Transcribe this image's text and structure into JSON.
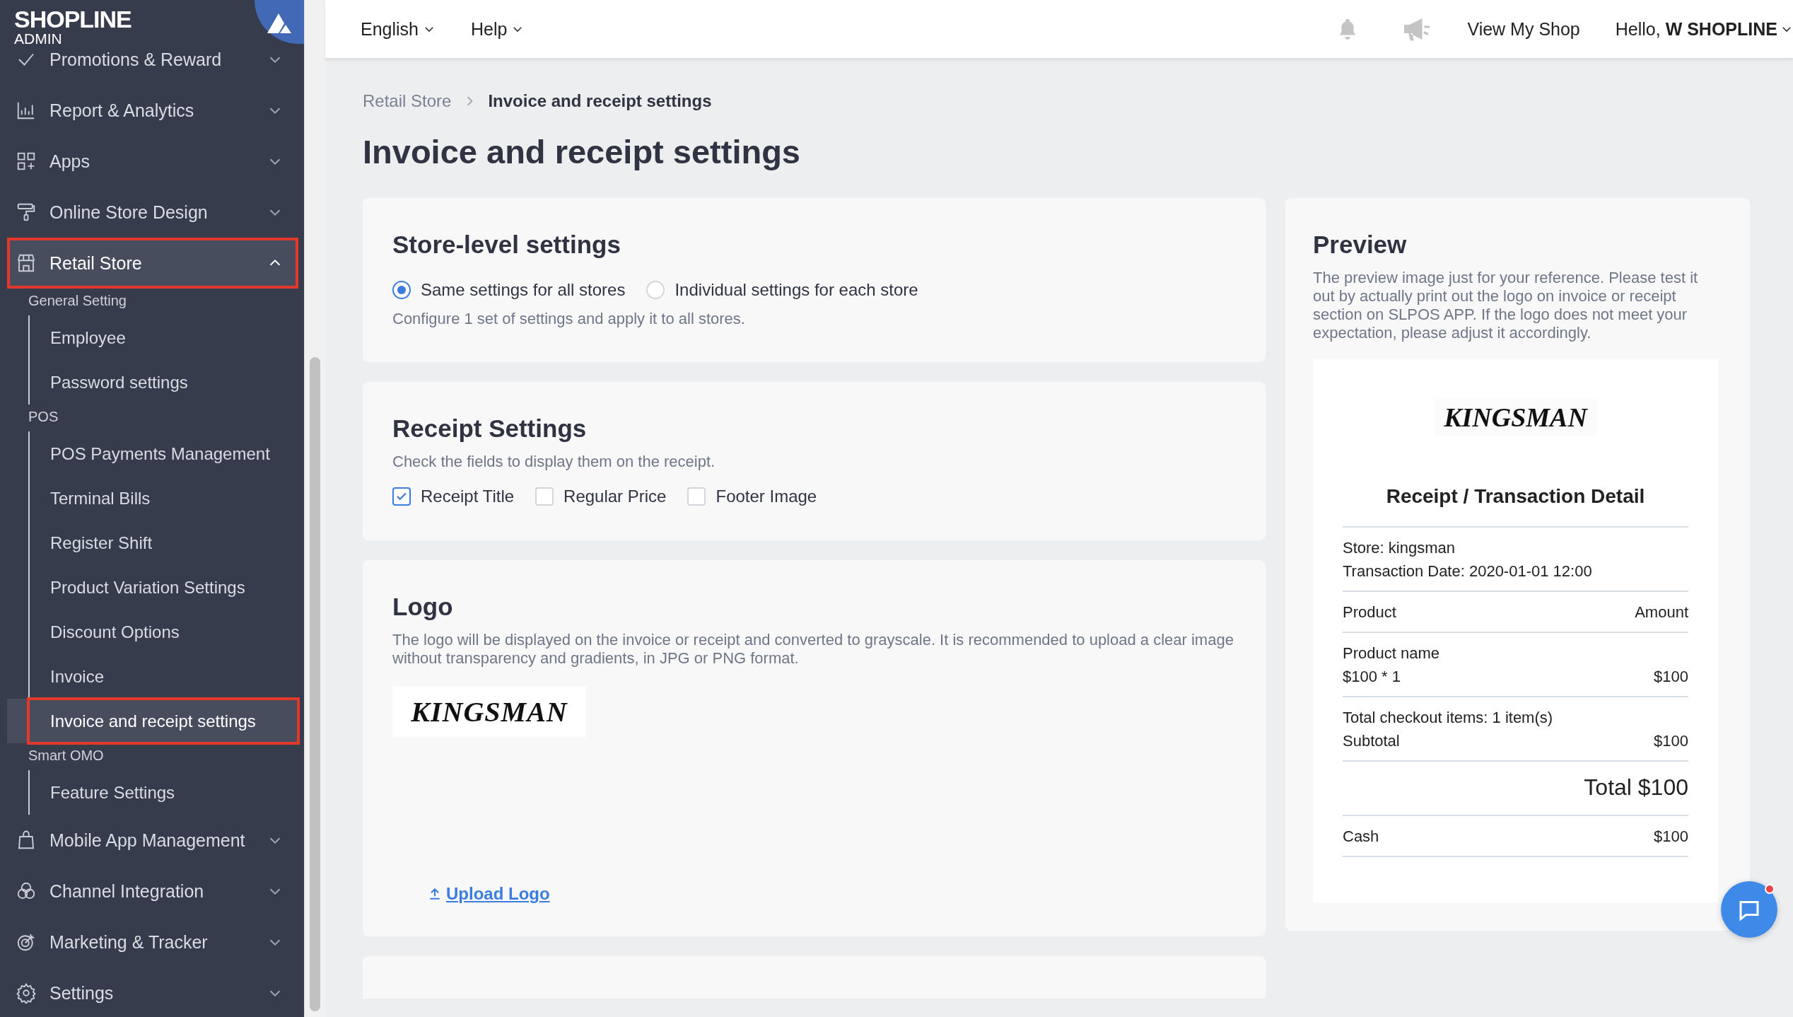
{
  "sidebar": {
    "brand": "SHOPLINE",
    "brand_sub": "ADMIN",
    "items": [
      {
        "kind": "group",
        "label": "Promotions & Reward",
        "expanded": false,
        "selected": false,
        "highlighted": false
      },
      {
        "kind": "group",
        "label": "Report & Analytics",
        "expanded": false,
        "selected": false,
        "highlighted": false
      },
      {
        "kind": "group",
        "label": "Apps",
        "expanded": false,
        "selected": false,
        "highlighted": false
      },
      {
        "kind": "group",
        "label": "Online Store Design",
        "expanded": false,
        "selected": false,
        "highlighted": false
      },
      {
        "kind": "group",
        "label": "Retail Store",
        "expanded": true,
        "selected": true,
        "highlighted": true
      },
      {
        "kind": "section",
        "label": "General Setting"
      },
      {
        "kind": "link",
        "label": "Employee",
        "selected": false,
        "highlighted": false
      },
      {
        "kind": "link",
        "label": "Password settings",
        "selected": false,
        "highlighted": false
      },
      {
        "kind": "section",
        "label": "POS"
      },
      {
        "kind": "link",
        "label": "POS Payments Management",
        "selected": false,
        "highlighted": false
      },
      {
        "kind": "link",
        "label": "Terminal Bills",
        "selected": false,
        "highlighted": false
      },
      {
        "kind": "link",
        "label": "Register Shift",
        "selected": false,
        "highlighted": false
      },
      {
        "kind": "link",
        "label": "Product Variation Settings",
        "selected": false,
        "highlighted": false
      },
      {
        "kind": "link",
        "label": "Discount Options",
        "selected": false,
        "highlighted": false
      },
      {
        "kind": "link",
        "label": "Invoice",
        "selected": false,
        "highlighted": false
      },
      {
        "kind": "link",
        "label": "Invoice and receipt settings",
        "selected": true,
        "highlighted": true
      },
      {
        "kind": "section",
        "label": "Smart OMO"
      },
      {
        "kind": "link",
        "label": "Feature Settings",
        "selected": false,
        "highlighted": false
      },
      {
        "kind": "group",
        "label": "Mobile App Management",
        "expanded": false,
        "selected": false,
        "highlighted": false
      },
      {
        "kind": "group",
        "label": "Channel Integration",
        "expanded": false,
        "selected": false,
        "highlighted": false
      },
      {
        "kind": "group",
        "label": "Marketing & Tracker",
        "expanded": false,
        "selected": false,
        "highlighted": false
      },
      {
        "kind": "group",
        "label": "Settings",
        "expanded": false,
        "selected": false,
        "highlighted": false
      }
    ]
  },
  "topbar": {
    "menus": [
      "English",
      "Help"
    ],
    "view_shop": "View My Shop",
    "greeting": "Hello, **W SHOPLINE**"
  },
  "breadcrumb": [
    "Retail Store",
    "Invoice and receipt settings"
  ],
  "title": "Invoice and receipt settings",
  "store_level": {
    "title": "Store-level settings",
    "options": [
      {
        "label": "Same settings for all stores",
        "selected": true
      },
      {
        "label": "Individual settings for each store",
        "selected": false
      }
    ],
    "hint": "Configure 1 set of settings and apply it to all stores."
  },
  "receipt_settings": {
    "title": "Receipt Settings",
    "hint": "Check the fields to display them on the receipt.",
    "fields": [
      {
        "label": "Receipt Title",
        "checked": true
      },
      {
        "label": "Regular Price",
        "checked": false
      },
      {
        "label": "Footer Image",
        "checked": false
      }
    ]
  },
  "logo": {
    "title": "Logo",
    "hint": "The logo will be displayed on the invoice or receipt and converted to grayscale. It is recommended to upload a clear image without transparency and gradients, in JPG or PNG format.",
    "image_text": "KINGSMAN",
    "upload": "Upload Logo"
  },
  "preview": {
    "title": "Preview",
    "hint": "The preview image just for your reference. Please test it out by actually print out the logo on invoice or receipt section on SLPOS APP. If the logo does not meet your expectation, please adjust it accordingly.",
    "receipt": {
      "logo": "KINGSMAN",
      "title": "Receipt / Transaction Detail",
      "sections": [
        {
          "kind": "normal",
          "rows": [
            {
              "left": "Store: kingsman"
            },
            {
              "left": "Transaction Date: 2020-01-01 12:00"
            }
          ]
        },
        {
          "kind": "normal",
          "rows": [
            {
              "left": "Product",
              "right": "Amount"
            }
          ]
        },
        {
          "kind": "normal",
          "rows": [
            {
              "left": "Product name"
            },
            {
              "left": "$100 * 1",
              "right": "$100"
            }
          ]
        },
        {
          "kind": "normal",
          "rows": [
            {
              "left": "Total checkout items: 1 item(s)"
            },
            {
              "left": "Subtotal",
              "right": "$100"
            }
          ]
        },
        {
          "kind": "total",
          "rows": [
            {
              "right": "Total $100"
            }
          ]
        },
        {
          "kind": "normal",
          "rows": [
            {
              "left": "Cash",
              "right": "$100"
            }
          ]
        }
      ]
    }
  },
  "chat": {
    "unread": true
  }
}
